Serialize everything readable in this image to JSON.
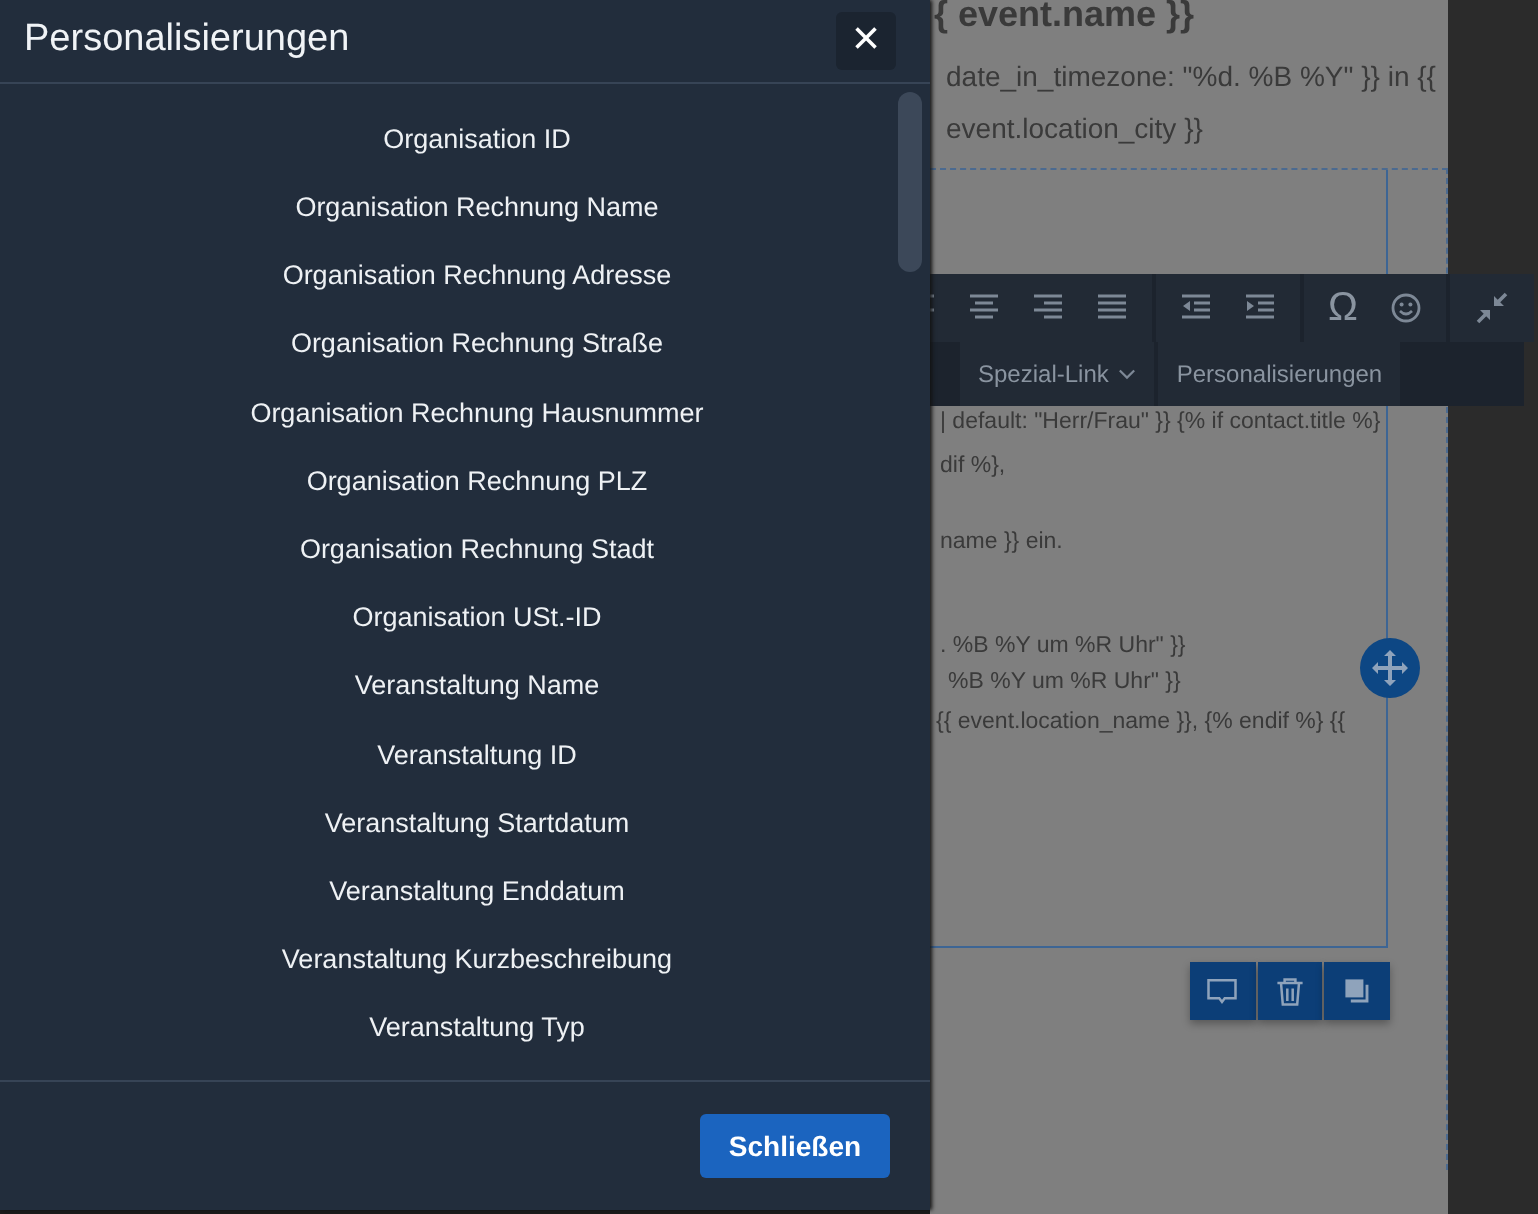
{
  "editor": {
    "heading": "{ event.name }}",
    "intro_lines": [
      "date_in_timezone: \"%d. %B %Y\" }} in {{",
      "event.location_city }}"
    ],
    "toolbar": {
      "symbol": "Ω",
      "menus": [
        {
          "label": "Spezial-Link",
          "dropdown": true
        },
        {
          "label": "Personalisierungen",
          "dropdown": false
        }
      ]
    },
    "lines": [
      "| default: \"Herr/Frau\" }} {% if contact.title %}",
      "dif %},",
      "name }} ein.",
      ". %B %Y um %R Uhr\" }}",
      "%B %Y um %R Uhr\" }}",
      "{{ event.location_name }}, {% endif %} {{"
    ]
  },
  "dialog": {
    "title": "Personalisierungen",
    "close": "×",
    "items": [
      "Organisation ID",
      "Organisation Rechnung Name",
      "Organisation Rechnung Adresse",
      "Organisation Rechnung Straße",
      "Organisation Rechnung Hausnummer",
      "Organisation Rechnung PLZ",
      "Organisation Rechnung Stadt",
      "Organisation USt.-ID",
      "Veranstaltung Name",
      "Veranstaltung ID",
      "Veranstaltung Startdatum",
      "Veranstaltung Enddatum",
      "Veranstaltung Kurzbeschreibung",
      "Veranstaltung Typ"
    ],
    "buttons": [
      "Schließen"
    ]
  }
}
